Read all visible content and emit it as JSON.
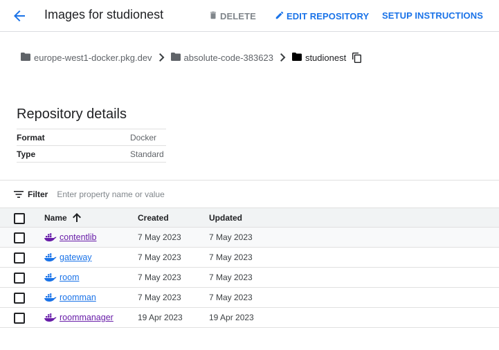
{
  "header": {
    "title": "Images for studionest",
    "delete_label": "DELETE",
    "edit_label": "EDIT REPOSITORY",
    "setup_label": "SETUP INSTRUCTIONS"
  },
  "breadcrumb": {
    "items": [
      "europe-west1-docker.pkg.dev",
      "absolute-code-383623",
      "studionest"
    ]
  },
  "repository_details": {
    "title": "Repository details",
    "rows": [
      {
        "key": "Format",
        "value": "Docker"
      },
      {
        "key": "Type",
        "value": "Standard"
      }
    ]
  },
  "filter": {
    "label": "Filter",
    "placeholder": "Enter property name or value"
  },
  "table": {
    "columns": {
      "name": "Name",
      "created": "Created",
      "updated": "Updated"
    },
    "sort": {
      "column": "Name",
      "direction": "ascending"
    },
    "rows": [
      {
        "name": "contentlib",
        "created": "7 May 2023",
        "updated": "7 May 2023"
      },
      {
        "name": "gateway",
        "created": "7 May 2023",
        "updated": "7 May 2023"
      },
      {
        "name": "room",
        "created": "7 May 2023",
        "updated": "7 May 2023"
      },
      {
        "name": "roomman",
        "created": "7 May 2023",
        "updated": "7 May 2023"
      },
      {
        "name": "roommanager",
        "created": "19 Apr 2023",
        "updated": "19 Apr 2023"
      }
    ]
  },
  "colors": {
    "accent": "#1a73e8",
    "visited_link": "#681da8",
    "muted": "#80868b"
  },
  "icons": [
    "back-arrow-icon",
    "trash-icon",
    "pencil-icon",
    "folder-icon",
    "chevron-right-icon",
    "copy-icon",
    "filter-icon",
    "sort-arrow-up-icon",
    "docker-whale-icon"
  ]
}
